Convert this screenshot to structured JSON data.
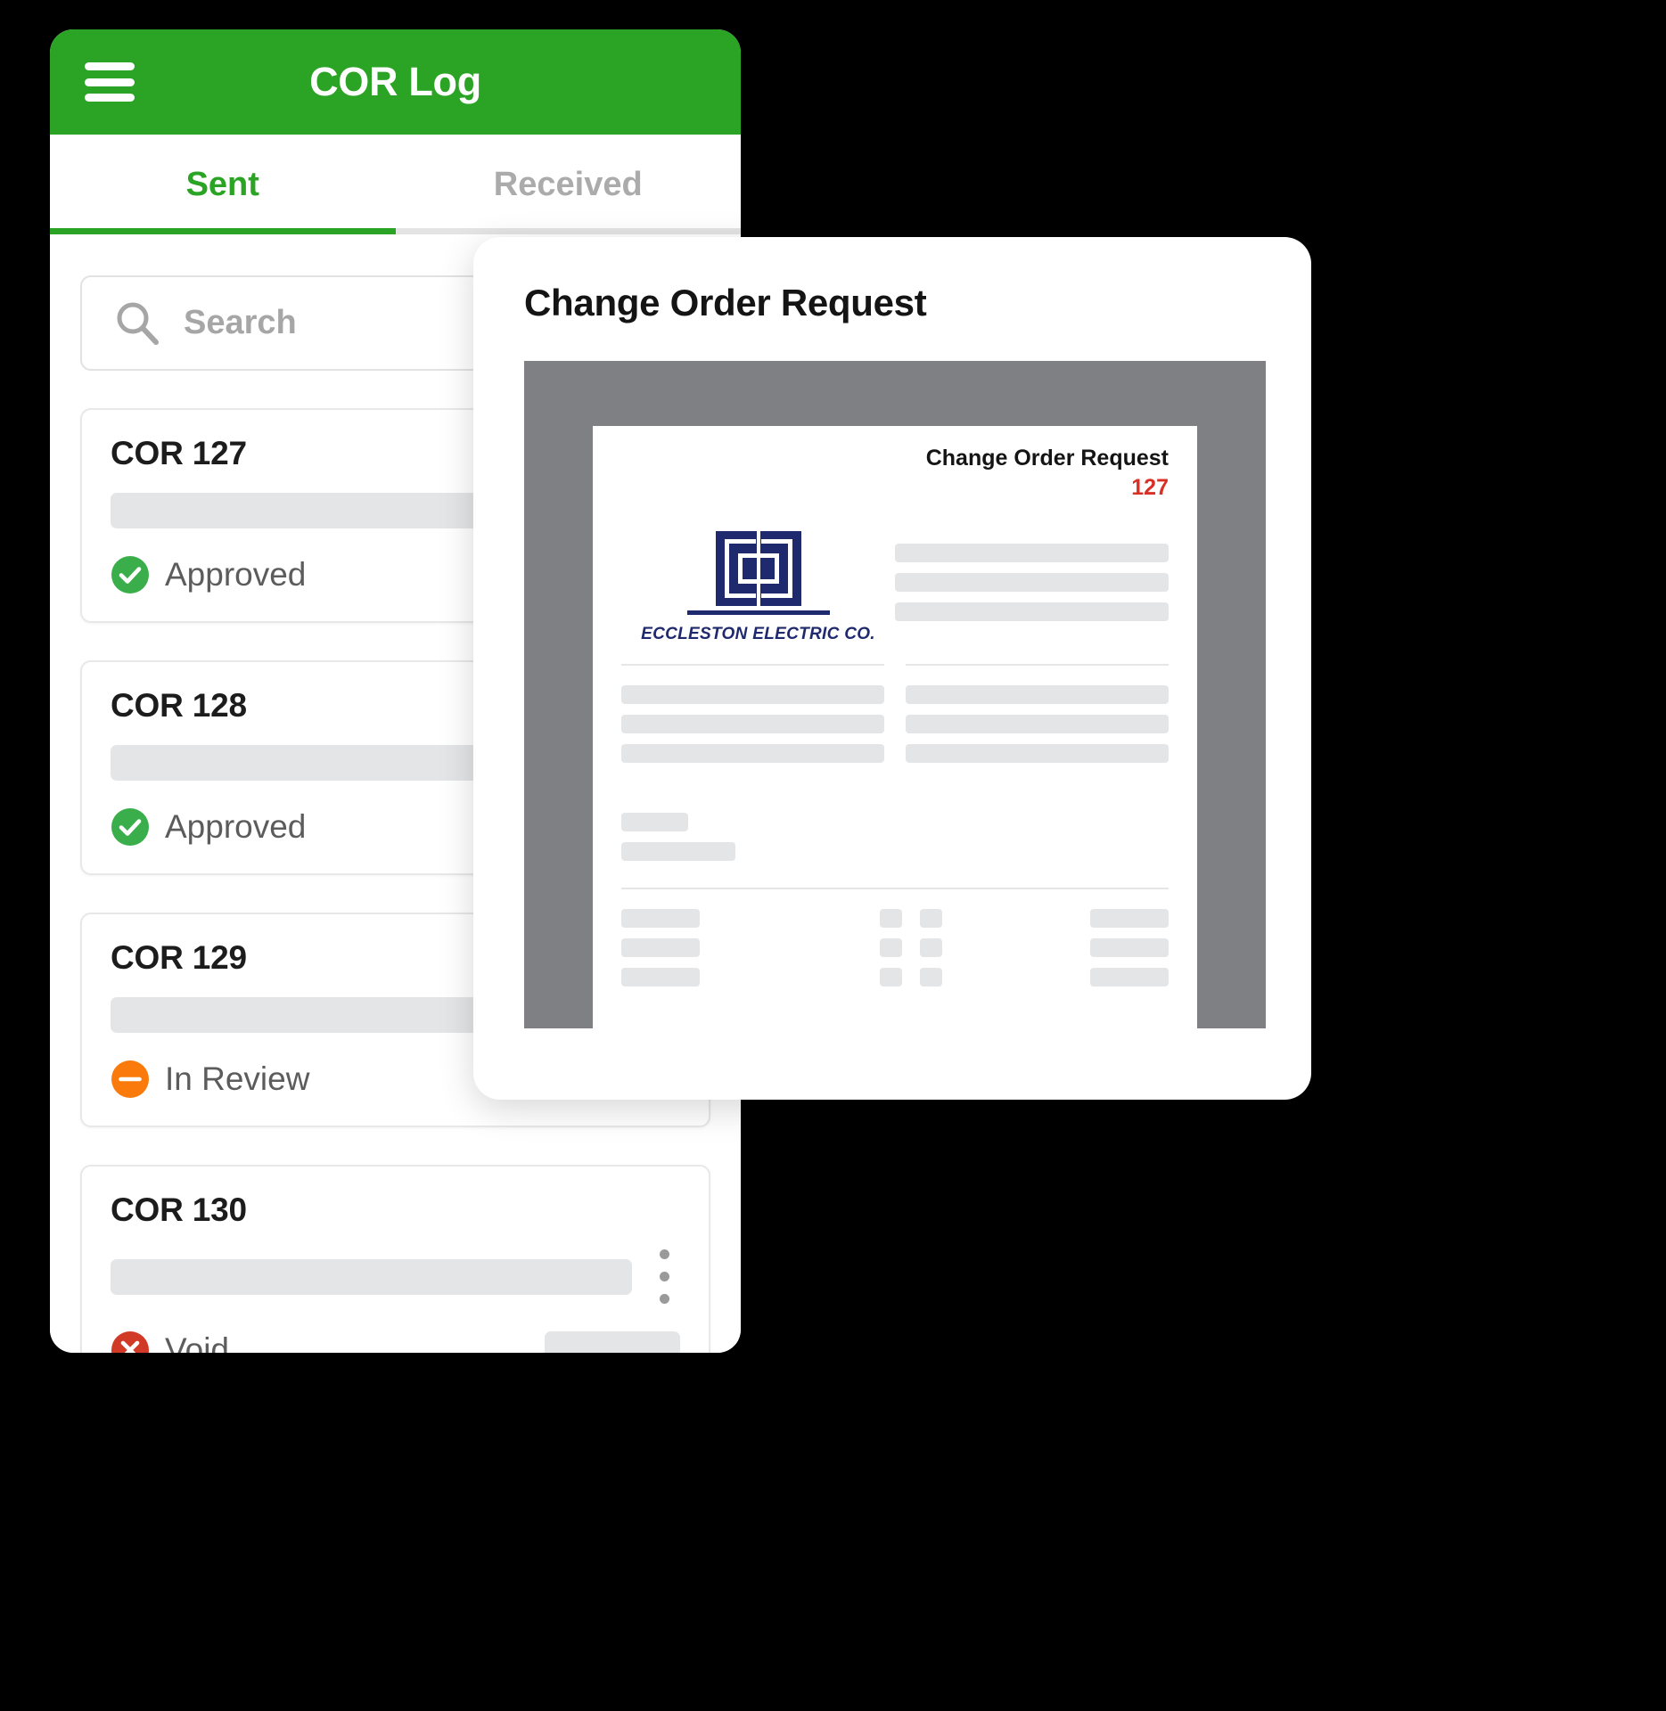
{
  "app": {
    "title": "COR Log",
    "menu_icon": "hamburger-icon",
    "tabs": [
      {
        "label": "Sent",
        "active": true
      },
      {
        "label": "Received",
        "active": false
      }
    ],
    "search": {
      "placeholder": "Search",
      "icon": "search-icon",
      "value": ""
    },
    "cor_items": [
      {
        "title": "COR 127",
        "status": "Approved",
        "status_type": "approved",
        "status_color": "#3AAE4A",
        "has_kebab": false,
        "has_footer_skeleton": false
      },
      {
        "title": "COR 128",
        "status": "Approved",
        "status_type": "approved",
        "status_color": "#3AAE4A",
        "has_kebab": false,
        "has_footer_skeleton": false
      },
      {
        "title": "COR 129",
        "status": "In Review",
        "status_type": "in-review",
        "status_color": "#FA7B0C",
        "has_kebab": false,
        "has_footer_skeleton": false
      },
      {
        "title": "COR 130",
        "status": "Void",
        "status_type": "void",
        "status_color": "#D13A26",
        "has_kebab": true,
        "has_footer_skeleton": true
      }
    ]
  },
  "preview": {
    "card_title": "Change Order Request",
    "document": {
      "header_title": "Change Order Request",
      "header_number": "127",
      "logo": {
        "icon": "eccleston-logo-icon",
        "company_name": "ECCLESTON ELECTRIC CO.",
        "color": "#1F2A6E"
      }
    }
  },
  "colors": {
    "brand_green": "#2BA425",
    "tab_active": "#2BA425",
    "tab_inactive": "#ABABAB",
    "approved": "#3AAE4A",
    "in_review": "#FA7B0C",
    "void": "#D13A26",
    "doc_number_red": "#D93025",
    "logo_navy": "#1F2A6E",
    "viewport_gray": "#7F8083",
    "skeleton": "#E4E5E7"
  }
}
